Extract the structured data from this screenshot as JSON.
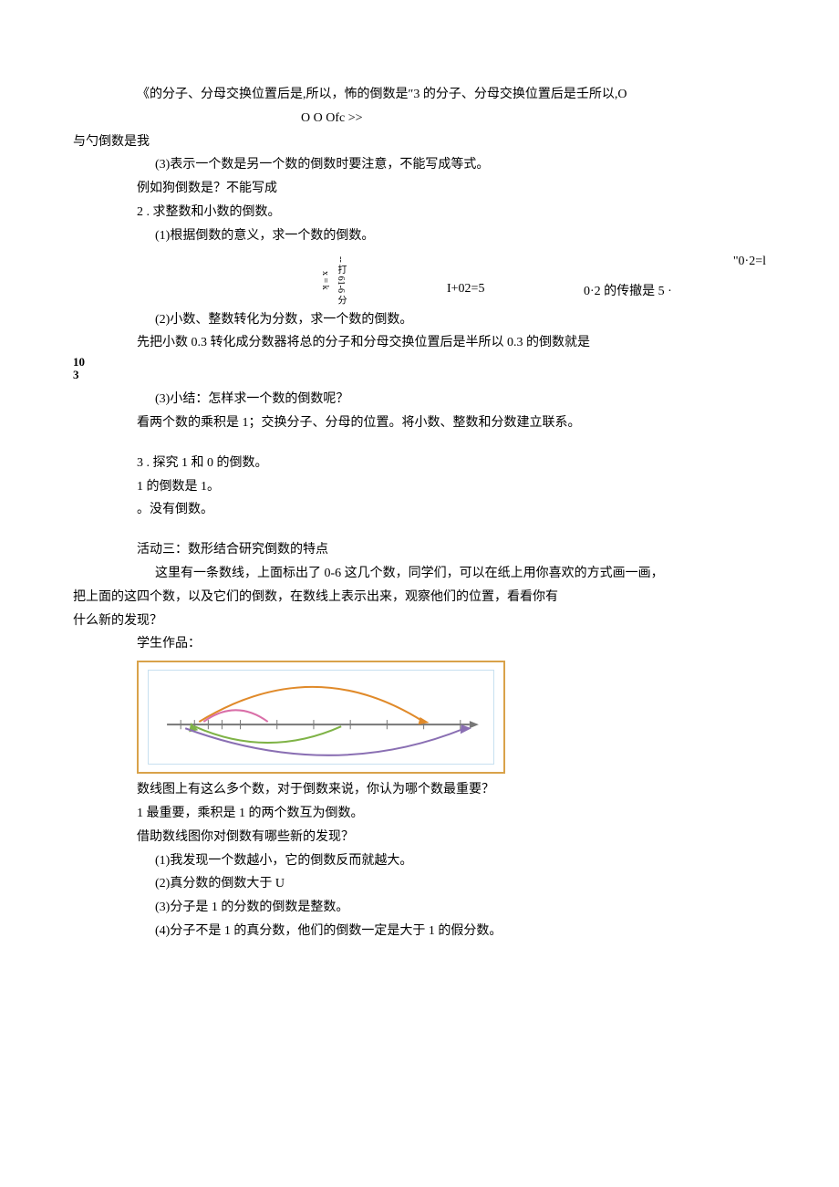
{
  "p1": "《的分子、分母交换位置后是,所以，怖的倒数是″3 的分子、分母交换位置后是壬所以,O",
  "p1b": "O        O        Ofc                                            >>",
  "p2": "与勺倒数是我",
  "p3": "(3)表示一个数是另一个数的倒数时要注意，不能写成等式。",
  "p4": "例如狗倒数是？不能写成",
  "p5": "2 . 求整数和小数的倒数。",
  "p6": "(1)根据倒数的意义，求一个数的倒数。",
  "vcol": "-- 打 61-6 分 x = k",
  "m1": "\"0·2=l",
  "m2": "I+02=5",
  "m3": "0·2 的传撤是 5 ·",
  "p7": "(2)小数、整数转化为分数，求一个数的倒数。",
  "p8": "先把小数 0.3 转化成分数器将总的分子和分母交换位置后是半所以 0.3 的倒数就是",
  "frac_top": "10",
  "frac_bot": "3",
  "p9": "(3)小结：怎样求一个数的倒数呢？",
  "p10": "看两个数的乘积是 1；交换分子、分母的位置。将小数、整数和分数建立联系。",
  "p11": "3 . 探究 1 和 0 的倒数。",
  "p12": "1 的倒数是 1。",
  "p13": "。没有倒数。",
  "p14": "活动三：数形结合研究倒数的特点",
  "p15": "这里有一条数线，上面标出了 0-6 这几个数，同学们，可以在纸上用你喜欢的方式画一画，",
  "p16": "把上面的这四个数，以及它们的倒数，在数线上表示出来，观察他们的位置，看看你有",
  "p17": "什么新的发现？",
  "p18": "学生作品：",
  "p19": "数线图上有这么多个数，对于倒数来说，你认为哪个数最重要？",
  "p20": "1 最重要，乘积是 1 的两个数互为倒数。",
  "p21": "借助数线图你对倒数有哪些新的发现？",
  "p22": "(1)我发现一个数越小，它的倒数反而就越大。",
  "p23": "(2)真分数的倒数大于 U",
  "p24": "(3)分子是 1 的分数的倒数是整数。",
  "p25": "(4)分子不是 1 的真分数，他们的倒数一定是大于 1 的假分数。"
}
